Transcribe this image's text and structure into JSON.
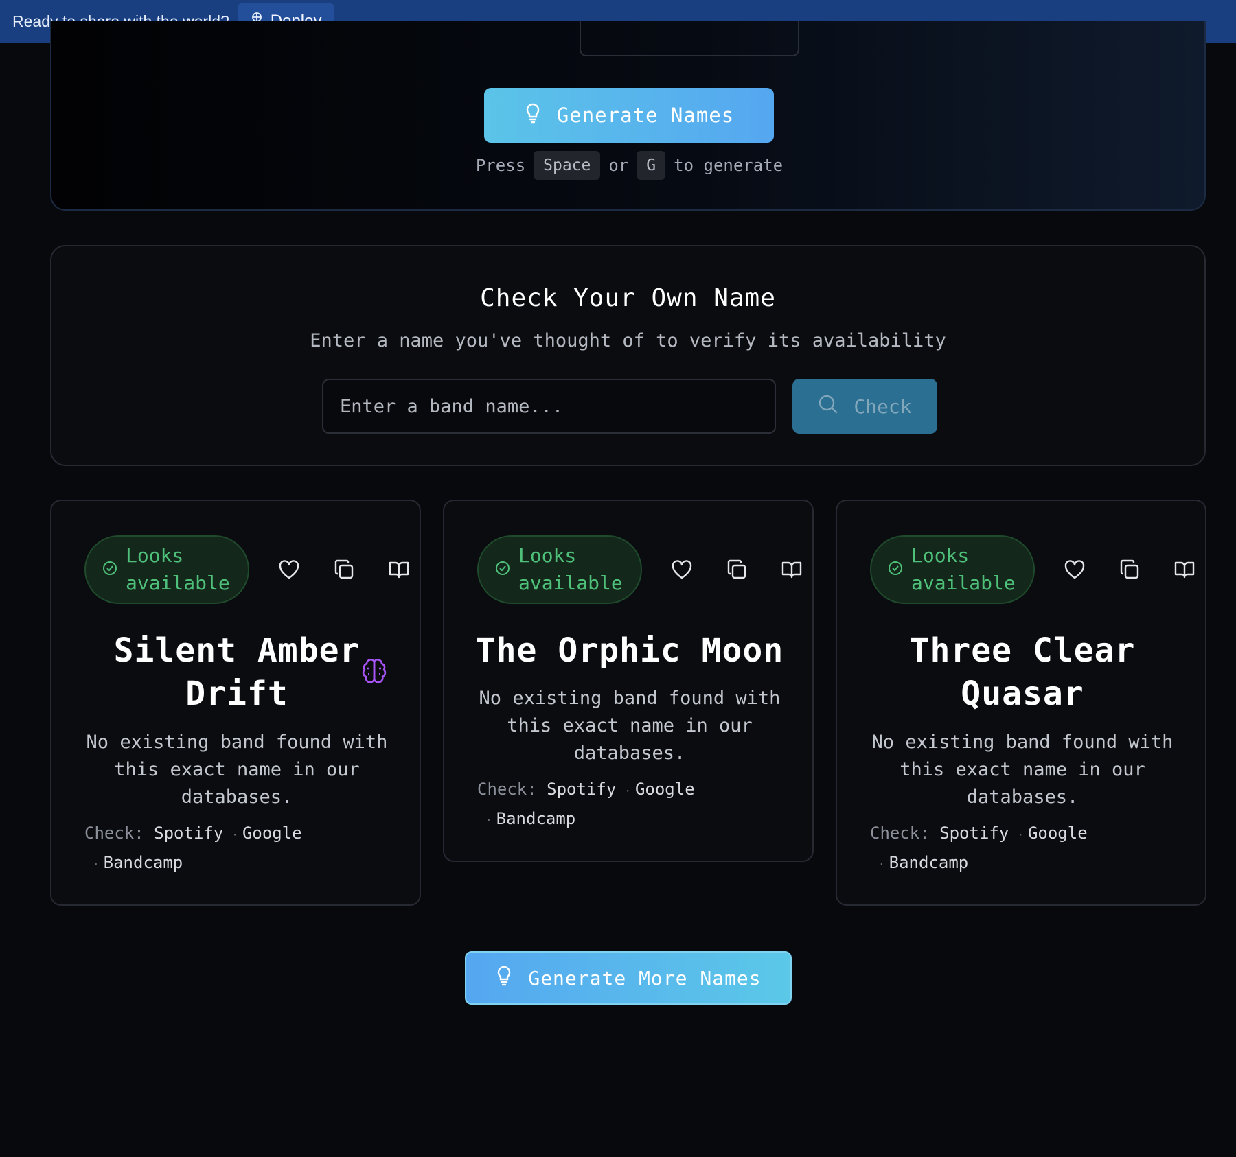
{
  "topbar": {
    "message": "Ready to share with the world?",
    "deploy_label": "Deploy"
  },
  "generator": {
    "button_label": "Generate Names",
    "hint_press": "Press",
    "hint_key1": "Space",
    "hint_or": "or",
    "hint_key2": "G",
    "hint_suffix": "to generate"
  },
  "check_panel": {
    "title": "Check Your Own Name",
    "subtitle": "Enter a name you've thought of to verify its availability",
    "input_placeholder": "Enter a band name...",
    "input_value": "",
    "button_label": "Check"
  },
  "cards": [
    {
      "badge_line1": "Looks",
      "badge_line2": "available",
      "name": "Silent Amber Drift",
      "description": "No existing band found with this exact name in our databases.",
      "check_label": "Check:",
      "links": [
        "Spotify",
        "Google",
        "Bandcamp"
      ],
      "icons": [
        "heart-icon",
        "copy-icon",
        "book-icon",
        "brain-icon"
      ]
    },
    {
      "badge_line1": "Looks",
      "badge_line2": "available",
      "name": "The Orphic Moon",
      "description": "No existing band found with this exact name in our databases.",
      "check_label": "Check:",
      "links": [
        "Spotify",
        "Google",
        "Bandcamp"
      ],
      "icons": [
        "heart-icon",
        "copy-icon",
        "book-icon"
      ]
    },
    {
      "badge_line1": "Looks",
      "badge_line2": "available",
      "name": "Three Clear Quasar",
      "description": "No existing band found with this exact name in our databases.",
      "check_label": "Check:",
      "links": [
        "Spotify",
        "Google",
        "Bandcamp"
      ],
      "icons": [
        "heart-icon",
        "copy-icon",
        "book-icon"
      ]
    }
  ],
  "more_button_label": "Generate More Names",
  "colors": {
    "topbar": "#1a3f80",
    "accent_blue": "#55a7f0",
    "available_green": "#4ec07a",
    "brain_purple": "#a855f7",
    "page_bg": "#08090d"
  }
}
